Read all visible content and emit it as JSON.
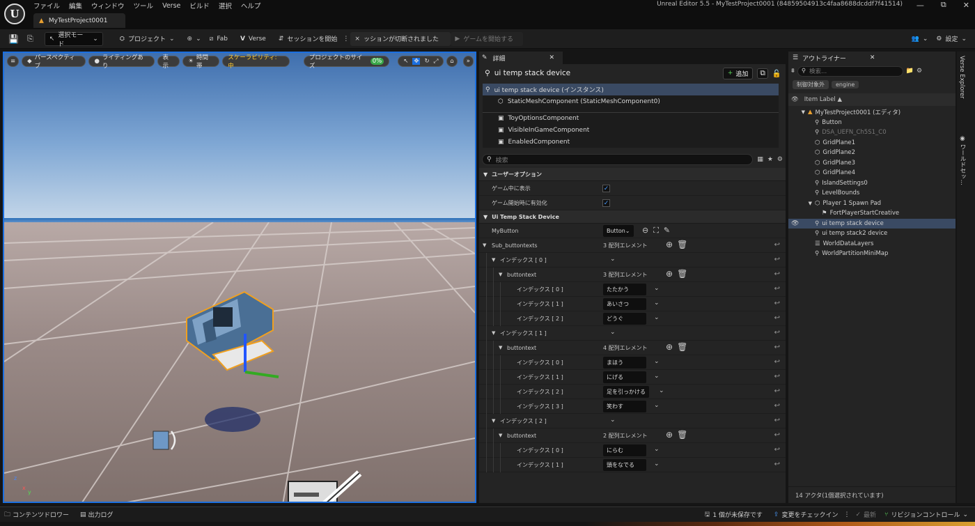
{
  "window": {
    "title": "Unreal Editor 5.5 - MyTestProject0001 (84859504913c4faa8688dcddf7f41514)",
    "menus": [
      "ファイル",
      "編集",
      "ウィンドウ",
      "ツール",
      "Verse",
      "ビルド",
      "選択",
      "ヘルプ"
    ],
    "project_tab": "MyTestProject0001",
    "controls": [
      "—",
      "⧉",
      "✕"
    ]
  },
  "toolbar": {
    "select_mode": "選択モード",
    "project": "プロジェクト",
    "fab": "Fab",
    "verse": "Verse",
    "session_start": "セッションを開始",
    "session_status": "ッションが切断されました",
    "start_game": "ゲームを開始する",
    "settings": "設定"
  },
  "viewport": {
    "perspective": "パースペクティブ",
    "lighting": "ライティングあり",
    "show": "表示",
    "time": "時間帯",
    "scalability": "スケーラビリティ: 中",
    "project_size": "プロジェクトのサイズ",
    "project_size_value": "0%"
  },
  "details": {
    "tab": "詳細",
    "object_name": "ui temp stack device",
    "add_label": "追加",
    "components": [
      {
        "label": "ui temp stack device (インスタンス)",
        "selected": true,
        "indent": 0
      },
      {
        "label": "StaticMeshComponent (StaticMeshComponent0)",
        "selected": false,
        "indent": 1
      },
      {
        "label": "ToyOptionsComponent",
        "selected": false,
        "indent": 1
      },
      {
        "label": "VisibleInGameComponent",
        "selected": false,
        "indent": 1
      },
      {
        "label": "EnabledComponent",
        "selected": false,
        "indent": 1
      }
    ],
    "search_placeholder": "検索",
    "user_options": {
      "header": "ユーザーオプション",
      "show_in_game": "ゲーム中に表示",
      "enable_on_start": "ゲーム開始時に有効化"
    },
    "device_section": {
      "header": "Ui Temp Stack Device",
      "mybutton_label": "MyButton",
      "mybutton_value": "Button",
      "sub_label": "Sub_buttontexts",
      "sub_count": "3 配列エレメント",
      "groups": [
        {
          "index_label": "インデックス [ 0 ]",
          "buttontext_label": "buttontext",
          "count": "3 配列エレメント",
          "items": [
            {
              "label": "インデックス [ 0 ]",
              "value": "たたかう"
            },
            {
              "label": "インデックス [ 1 ]",
              "value": "あいさつ"
            },
            {
              "label": "インデックス [ 2 ]",
              "value": "どうぐ"
            }
          ]
        },
        {
          "index_label": "インデックス [ 1 ]",
          "buttontext_label": "buttontext",
          "count": "4 配列エレメント",
          "items": [
            {
              "label": "インデックス [ 0 ]",
              "value": "まほう"
            },
            {
              "label": "インデックス [ 1 ]",
              "value": "にげる"
            },
            {
              "label": "インデックス [ 2 ]",
              "value": "足を引っかける"
            },
            {
              "label": "インデックス [ 3 ]",
              "value": "笑わす"
            }
          ]
        },
        {
          "index_label": "インデックス [ 2 ]",
          "buttontext_label": "buttontext",
          "count": "2 配列エレメント",
          "items": [
            {
              "label": "インデックス [ 0 ]",
              "value": "にらむ"
            },
            {
              "label": "インデックス [ 1 ]",
              "value": "頭をなでる"
            }
          ]
        }
      ]
    }
  },
  "outliner": {
    "tab": "アウトライナー",
    "search_placeholder": "検索...",
    "filters": [
      "制御対象外",
      "engine"
    ],
    "column": "Item Label ▲",
    "items": [
      {
        "label": "MyTestProject0001 (エディタ)",
        "icon": "level-icon",
        "indent": 1,
        "selected": false,
        "dim": false,
        "expand": "▼"
      },
      {
        "label": "Button",
        "icon": "actor-icon",
        "indent": 2,
        "selected": false,
        "dim": false,
        "expand": ""
      },
      {
        "label": "DSA_UEFN_Ch5S1_C0",
        "icon": "actor-icon",
        "indent": 2,
        "selected": false,
        "dim": true,
        "expand": ""
      },
      {
        "label": "GridPlane1",
        "icon": "mesh-icon",
        "indent": 2,
        "selected": false,
        "dim": false,
        "expand": ""
      },
      {
        "label": "GridPlane2",
        "icon": "mesh-icon",
        "indent": 2,
        "selected": false,
        "dim": false,
        "expand": ""
      },
      {
        "label": "GridPlane3",
        "icon": "mesh-icon",
        "indent": 2,
        "selected": false,
        "dim": false,
        "expand": ""
      },
      {
        "label": "GridPlane4",
        "icon": "mesh-icon",
        "indent": 2,
        "selected": false,
        "dim": false,
        "expand": ""
      },
      {
        "label": "IslandSettings0",
        "icon": "actor-icon",
        "indent": 2,
        "selected": false,
        "dim": false,
        "expand": ""
      },
      {
        "label": "LevelBounds",
        "icon": "actor-icon",
        "indent": 2,
        "selected": false,
        "dim": false,
        "expand": ""
      },
      {
        "label": "Player 1 Spawn Pad",
        "icon": "mesh-icon",
        "indent": 2,
        "selected": false,
        "dim": false,
        "expand": "▼"
      },
      {
        "label": "FortPlayerStartCreative",
        "icon": "flag-icon",
        "indent": 3,
        "selected": false,
        "dim": false,
        "expand": ""
      },
      {
        "label": "ui temp stack device",
        "icon": "actor-icon",
        "indent": 2,
        "selected": true,
        "dim": false,
        "expand": ""
      },
      {
        "label": "ui temp stack2 device",
        "icon": "actor-icon",
        "indent": 2,
        "selected": false,
        "dim": false,
        "expand": ""
      },
      {
        "label": "WorldDataLayers",
        "icon": "layers-icon",
        "indent": 2,
        "selected": false,
        "dim": false,
        "expand": ""
      },
      {
        "label": "WorldPartitionMiniMap",
        "icon": "actor-icon",
        "indent": 2,
        "selected": false,
        "dim": false,
        "expand": ""
      }
    ],
    "footer": "14 アクタ(1個選択されています)"
  },
  "side_tabs": [
    "Verse Explorer",
    "ワールドセッ..."
  ],
  "statusbar": {
    "content_drawer": "コンテンツドロワー",
    "output_log": "出力ログ",
    "unsaved": "1 個が未保存です",
    "checkin": "変更をチェックイン",
    "latest": "最新",
    "revision": "リビジョンコントロール"
  }
}
